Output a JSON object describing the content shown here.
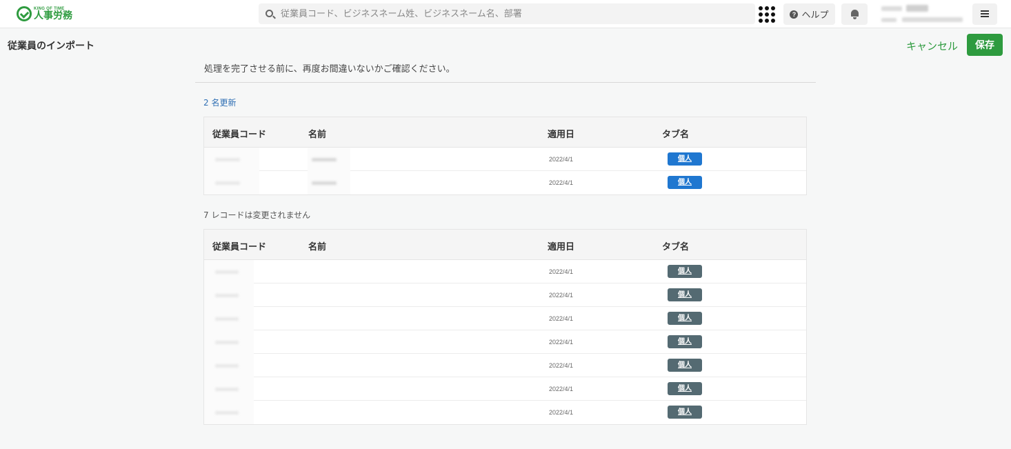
{
  "header": {
    "logo_small": "KING OF TIME",
    "logo_main": "人事労務",
    "search_placeholder": "従業員コード、ビジネスネーム姓、ビジネスネーム名、部署",
    "help_label": "ヘルプ"
  },
  "page": {
    "title": "従業員のインポート",
    "cancel_label": "キャンセル",
    "save_label": "保存",
    "confirm_message": "処理を完了させる前に、再度お間違いないかご確認ください。"
  },
  "columns": {
    "code": "従業員コード",
    "name": "名前",
    "date": "適用日",
    "tab": "タブ名"
  },
  "updated": {
    "label": "2 名更新",
    "rows": [
      {
        "date": "2022/4/1",
        "tab": "個人"
      },
      {
        "date": "2022/4/1",
        "tab": "個人"
      }
    ]
  },
  "unchanged": {
    "label": "7 レコードは変更されません",
    "rows": [
      {
        "date": "2022/4/1",
        "tab": "個人"
      },
      {
        "date": "2022/4/1",
        "tab": "個人"
      },
      {
        "date": "2022/4/1",
        "tab": "個人"
      },
      {
        "date": "2022/4/1",
        "tab": "個人"
      },
      {
        "date": "2022/4/1",
        "tab": "個人"
      },
      {
        "date": "2022/4/1",
        "tab": "個人"
      },
      {
        "date": "2022/4/1",
        "tab": "個人"
      }
    ]
  },
  "colors": {
    "brand_green": "#2e9b3f",
    "tag_blue": "#1f77d0",
    "tag_gray": "#546a72",
    "link_blue": "#2f6fb4"
  }
}
